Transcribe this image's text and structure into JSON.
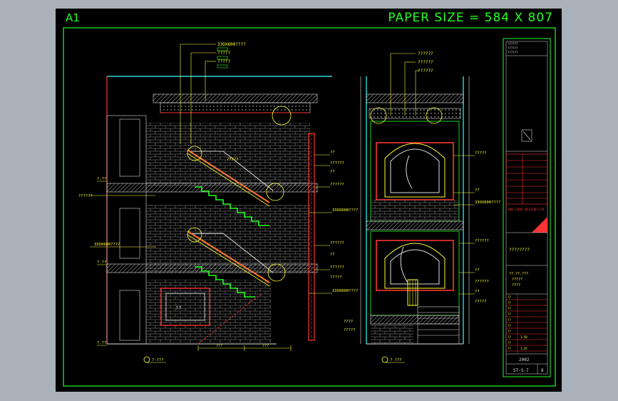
{
  "sheet": {
    "size_label": "A1",
    "paper_label": "PAPER SIZE = 584 X 807"
  },
  "colors": {
    "background": "#000000",
    "border": "#22ff22",
    "wall": "#ff3333",
    "dim": "#ffff33",
    "leader": "#ffff33",
    "cyan": "#33ffff",
    "magenta": "#ff33ff",
    "hatch": "#dddddd"
  },
  "left_elevation": {
    "callouts": [
      "33OX600????",
      "?????",
      "?????"
    ],
    "level_marks": [
      "?.??",
      "??????",
      "33OX600????",
      "?.??",
      "?.??"
    ],
    "notes_right": [
      "??",
      "??????",
      "??",
      "??????",
      "33OX600????",
      "??????",
      "??",
      "??????",
      "?????",
      "33OX600????"
    ],
    "mid_note": "?????",
    "dim_bottom": [
      "???",
      "???"
    ],
    "panel_note": "??",
    "section_mark": "?-???"
  },
  "right_elevation": {
    "callouts": [
      "??????",
      "??????",
      "??????"
    ],
    "notes_right": [
      "?????",
      "??",
      "33OX600????",
      "??????",
      "??",
      "??????",
      "??",
      "?????"
    ],
    "notes_left": [
      "????",
      "?????"
    ],
    "section_mark": "?-???"
  },
  "title_block": {
    "company_header": [
      "??????",
      "??????",
      "??????"
    ],
    "company_name": "ZHU CHAO DESIGN LTD.",
    "drawing_title": "????????",
    "project_lines": [
      "??.??.???",
      "?????",
      "????"
    ],
    "table_rows": [
      "??",
      "??",
      "??",
      "??",
      "??",
      "??",
      "??",
      "??",
      "??",
      "??",
      "??",
      "??"
    ],
    "scale_value": "1:50",
    "date_value": "1:35",
    "year": "2002",
    "sheet_no": "ST-S-7",
    "sheet_total": "8"
  }
}
